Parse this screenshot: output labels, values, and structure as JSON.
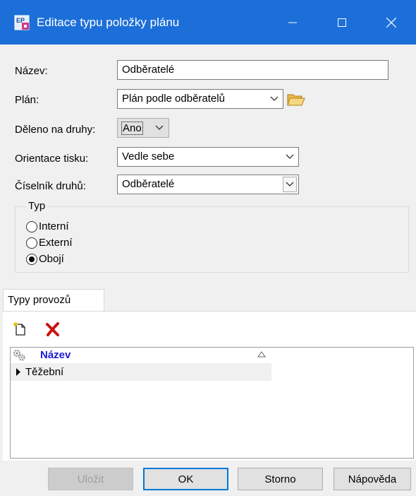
{
  "window": {
    "title": "Editace typu položky plánu"
  },
  "fields": {
    "nazev": {
      "label": "Název:",
      "value": "Odběratelé"
    },
    "plan": {
      "label": "Plán:",
      "value": "Plán podle odběratelů"
    },
    "deleno": {
      "label": "Děleno na druhy:",
      "value": "Ano"
    },
    "orientace": {
      "label": "Orientace tisku:",
      "value": "Vedle sebe"
    },
    "ciselnik": {
      "label": "Číselník druhů:",
      "value": "Odběratelé"
    }
  },
  "typ": {
    "legend": "Typ",
    "options": [
      {
        "label": "Interní",
        "selected": false
      },
      {
        "label": "Externí",
        "selected": false
      },
      {
        "label": "Obojí",
        "selected": true
      }
    ]
  },
  "tabs": [
    {
      "label": "Typy provozů"
    }
  ],
  "grid": {
    "columns": [
      {
        "label": "Název",
        "sort": "ascending"
      }
    ],
    "rows": [
      {
        "nazev": "Těžební"
      }
    ]
  },
  "buttons": {
    "save": "Uložit",
    "ok": "OK",
    "cancel": "Storno",
    "help": "Nápověda"
  },
  "colors": {
    "titlebar": "#1c6fd9",
    "header_text": "#1a1ad6",
    "delete": "#cc1010"
  }
}
